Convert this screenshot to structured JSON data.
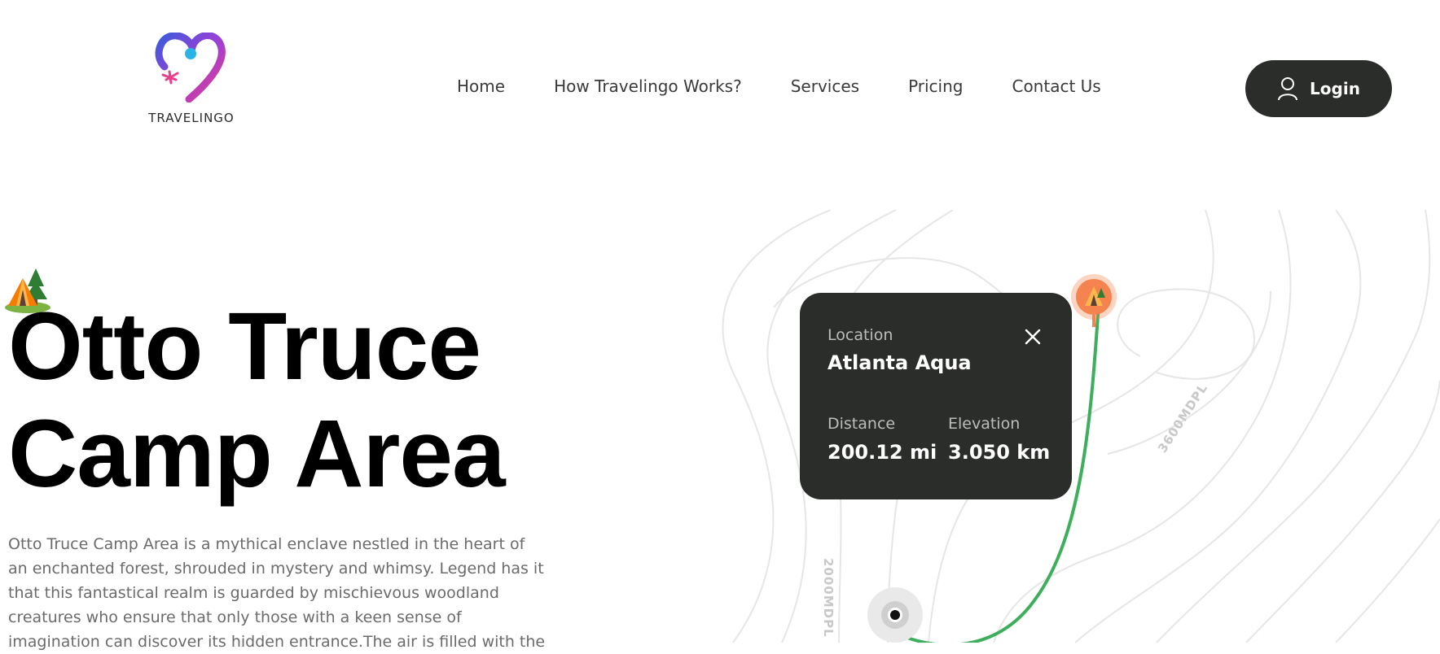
{
  "brand": {
    "name": "TRAVELINGO"
  },
  "nav": {
    "items": [
      {
        "label": "Home"
      },
      {
        "label": "How Travelingo Works?"
      },
      {
        "label": "Services"
      },
      {
        "label": "Pricing"
      },
      {
        "label": "Contact Us"
      }
    ]
  },
  "login": {
    "label": "Login",
    "icon": "user-icon"
  },
  "hero": {
    "title_line1": "Otto Truce",
    "title_line2": "Camp Area",
    "description": "Otto Truce Camp Area is a mythical enclave nestled in the heart of an enchanted forest, shrouded in mystery and whimsy. Legend has it that this fantastical realm is guarded by mischievous woodland creatures who ensure that only those with a keen sense of imagination can discover its hidden entrance.The air is filled with the"
  },
  "map": {
    "contour_labels": [
      "3600MDPL",
      "2000MDPL"
    ],
    "route_color": "#3dae5c",
    "pin_color": "#f4834f"
  },
  "location_card": {
    "location_label": "Location",
    "location_value": "Atlanta Aqua",
    "distance_label": "Distance",
    "distance_value": "200.12 mi",
    "elevation_label": "Elevation",
    "elevation_value": "3.050 km",
    "close_icon": "close-icon"
  },
  "colors": {
    "dark": "#2b2d2a",
    "accent_route": "#3dae5c",
    "pin": "#f4834f"
  }
}
